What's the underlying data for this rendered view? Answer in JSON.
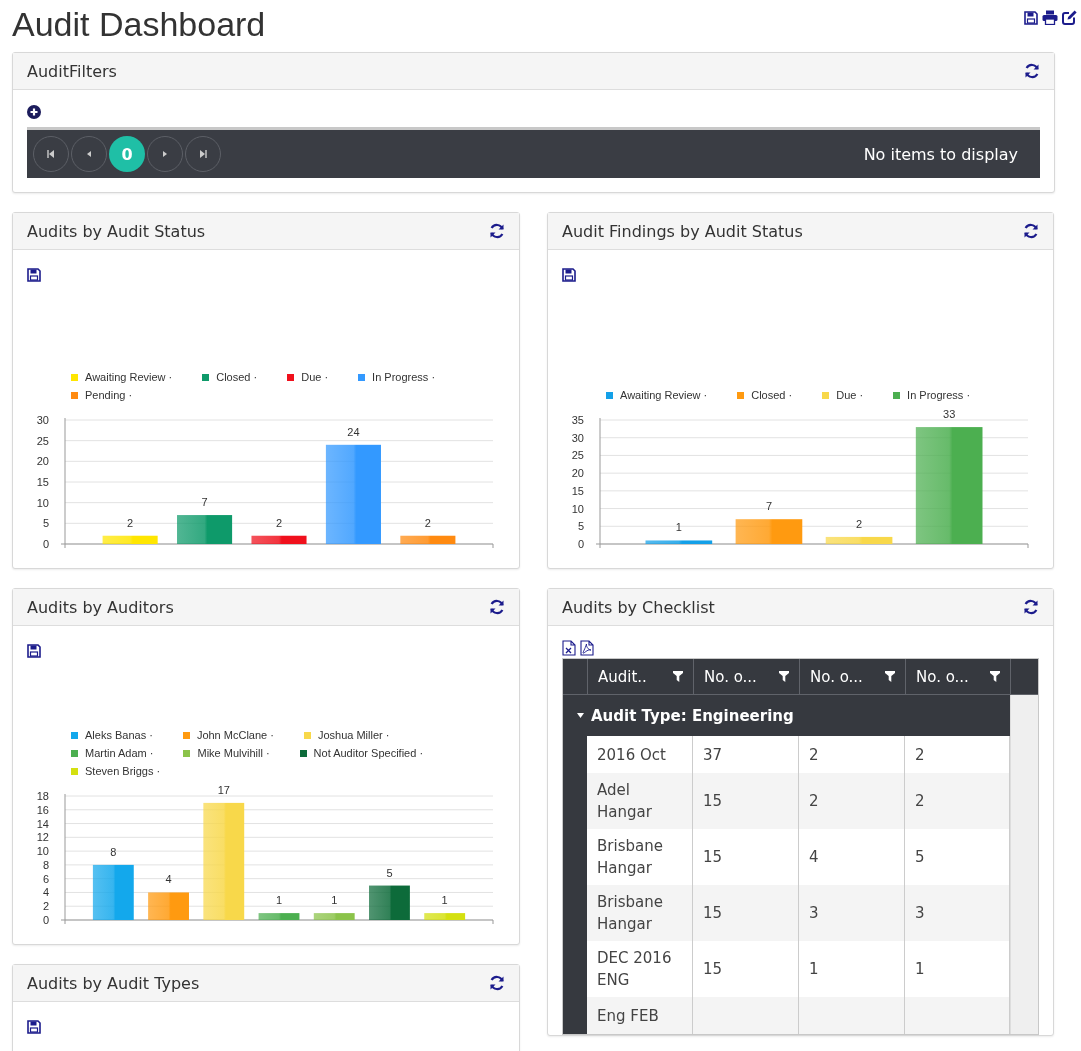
{
  "page_title": "Audit Dashboard",
  "filters_panel": {
    "title": "AuditFilters",
    "pager": {
      "pages": [
        {
          "label": "0",
          "selected": true
        }
      ],
      "status": "No items to display"
    }
  },
  "left_column": [
    {
      "kind": "chart",
      "title": "Audits by Audit Status",
      "chart_data": {
        "type": "bar",
        "grid": true,
        "ylim": [
          0,
          30
        ],
        "yticks": [
          0,
          5,
          10,
          15,
          20,
          25,
          30
        ],
        "data_labels": true,
        "series": [
          {
            "name": "Awaiting Review ·",
            "color": "#ffe600",
            "values": [
              2
            ]
          },
          {
            "name": "Closed ·",
            "color": "#0e9a6a",
            "values": [
              7
            ]
          },
          {
            "name": "Due ·",
            "color": "#f0101c",
            "values": [
              2
            ]
          },
          {
            "name": "In Progress ·",
            "color": "#3399ff",
            "values": [
              24
            ]
          },
          {
            "name": "Pending ·",
            "color": "#ff8a10",
            "values": [
              2
            ]
          }
        ]
      }
    },
    {
      "kind": "chart",
      "title": "Audits by Auditors",
      "chart_data": {
        "type": "bar",
        "grid": true,
        "ylim": [
          0,
          18
        ],
        "yticks": [
          0,
          2,
          4,
          6,
          8,
          10,
          12,
          14,
          16,
          18
        ],
        "data_labels": true,
        "series": [
          {
            "name": "Aleks Banas ·",
            "color": "#13a8ec",
            "values": [
              8
            ]
          },
          {
            "name": "John McClane ·",
            "color": "#ff9a10",
            "values": [
              4
            ]
          },
          {
            "name": "Joshua Miller ·",
            "color": "#f8d84a",
            "values": [
              17
            ]
          },
          {
            "name": "Martin Adam ·",
            "color": "#4caf50",
            "values": [
              1
            ]
          },
          {
            "name": "Mike Mulvihill ·",
            "color": "#8bc34a",
            "values": [
              1
            ]
          },
          {
            "name": "Not Auditor Specified ·",
            "color": "#0d6b3a",
            "values": [
              5
            ]
          },
          {
            "name": "Steven Briggs ·",
            "color": "#d4e010",
            "values": [
              1
            ]
          }
        ]
      }
    },
    {
      "kind": "empty",
      "title": "Audits by Audit Types"
    }
  ],
  "right_column": [
    {
      "kind": "chart",
      "title": "Audit Findings by Audit Status",
      "chart_data": {
        "type": "bar",
        "grid": true,
        "ylim": [
          0,
          35
        ],
        "yticks": [
          0,
          5,
          10,
          15,
          20,
          25,
          30,
          35
        ],
        "data_labels": true,
        "series": [
          {
            "name": "Awaiting Review ·",
            "color": "#13a0e8",
            "values": [
              1
            ]
          },
          {
            "name": "Closed ·",
            "color": "#ff9a10",
            "values": [
              7
            ]
          },
          {
            "name": "Due ·",
            "color": "#f8d84a",
            "values": [
              2
            ]
          },
          {
            "name": "In Progress ·",
            "color": "#4caf50",
            "values": [
              33
            ]
          }
        ]
      }
    },
    {
      "kind": "table",
      "title": "Audits by Checklist",
      "columns": [
        "Audit..",
        "No. o...",
        "No. o...",
        "No. o..."
      ],
      "group": "Audit Type: Engineering",
      "rows": [
        [
          "2016 Oct",
          "37",
          "2",
          "2"
        ],
        [
          "Adel Hangar",
          "15",
          "2",
          "2"
        ],
        [
          "Brisbane Hangar",
          "15",
          "4",
          "5"
        ],
        [
          "Brisbane Hangar",
          "15",
          "3",
          "3"
        ],
        [
          "DEC 2016 ENG",
          "15",
          "1",
          "1"
        ],
        [
          "Eng FEB"
        ]
      ]
    }
  ]
}
